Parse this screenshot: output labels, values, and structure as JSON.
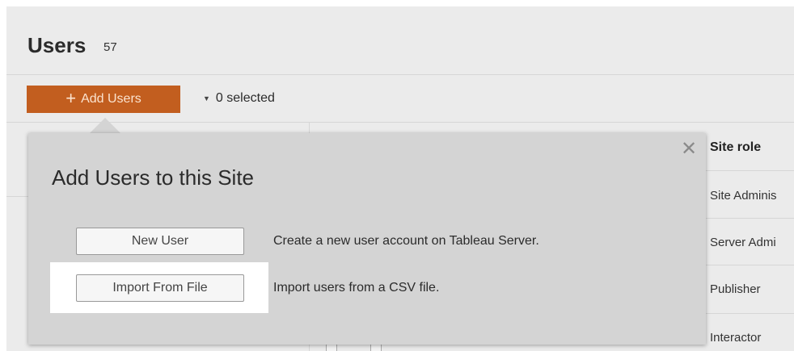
{
  "header": {
    "title": "Users",
    "count": "57"
  },
  "toolbar": {
    "add_users_label": "Add Users",
    "selected_label": "0 selected"
  },
  "table": {
    "column_header": "Site role",
    "roles": [
      "Site Adminis",
      "Server Admi",
      "Publisher",
      "Interactor"
    ]
  },
  "dialog": {
    "title": "Add Users to this Site",
    "options": [
      {
        "button_label": "New User",
        "description": "Create a new user account on Tableau Server."
      },
      {
        "button_label": "Import From File",
        "description": "Import users from a CSV file."
      }
    ]
  },
  "colors": {
    "accent": "#c25e1f",
    "popover_bg": "#d4d4d4",
    "page_bg": "#ebebeb"
  },
  "icons": {
    "close": "close-icon",
    "add": "plus-icon",
    "dropdown": "caret-down-icon"
  }
}
